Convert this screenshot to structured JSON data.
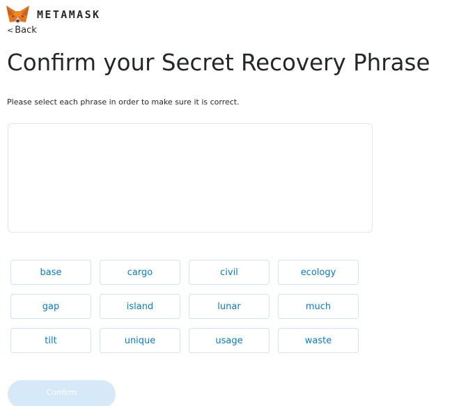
{
  "header": {
    "brand": "METAMASK",
    "logo_icon": "metamask-fox-icon"
  },
  "nav": {
    "back_chevron": "<",
    "back_label": "Back"
  },
  "main": {
    "title": "Confirm your Secret Recovery Phrase",
    "instructions": "Please select each phrase in order to make sure it is correct.",
    "selected_words": [],
    "words": [
      "base",
      "cargo",
      "civil",
      "ecology",
      "gap",
      "island",
      "lunar",
      "much",
      "tilt",
      "unique",
      "usage",
      "waste"
    ],
    "confirm_label": "Confirm",
    "confirm_enabled": false
  },
  "colors": {
    "accent": "#037dd6",
    "word_border": "#cfe3f7",
    "confirm_disabled_bg": "#d6e9f8",
    "fox_orange": "#e2761b"
  }
}
